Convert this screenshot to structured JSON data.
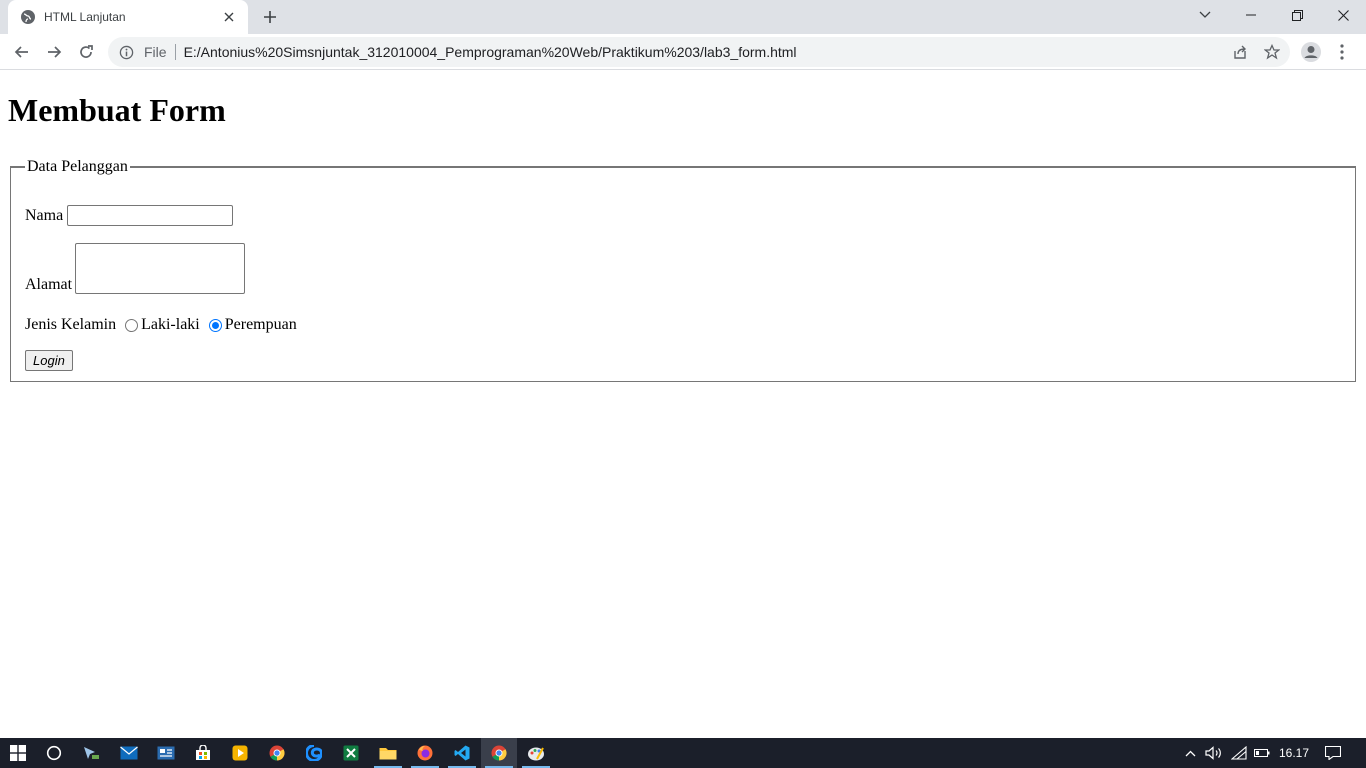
{
  "browser": {
    "tab": {
      "title": "HTML Lanjutan"
    },
    "omnibox": {
      "scheme_label": "File",
      "url": "E:/Antonius%20Simsnjuntak_312010004_Pemprograman%20Web/Praktikum%203/lab3_form.html"
    }
  },
  "page": {
    "heading": "Membuat Form",
    "fieldset": {
      "legend": "Data Pelanggan",
      "nama_label": "Nama",
      "nama_value": "",
      "alamat_label": "Alamat",
      "alamat_value": "",
      "gender_label": "Jenis Kelamin",
      "gender_options": [
        {
          "label": "Laki-laki",
          "checked": false
        },
        {
          "label": "Perempuan",
          "checked": true
        }
      ],
      "submit_label": "Login"
    }
  },
  "taskbar": {
    "clock": "16.17",
    "apps": [
      "start",
      "search",
      "mouse-app",
      "mail",
      "news",
      "store",
      "media-player",
      "chrome",
      "edge",
      "excel",
      "file-explorer",
      "firefox",
      "vscode",
      "chrome-active",
      "paint"
    ]
  },
  "colors": {
    "titlebar_bg": "#dee1e6",
    "omnibox_bg": "#f1f3f4",
    "radio_accent": "#0075ff",
    "taskbar_bg": "#1b1f2a"
  }
}
